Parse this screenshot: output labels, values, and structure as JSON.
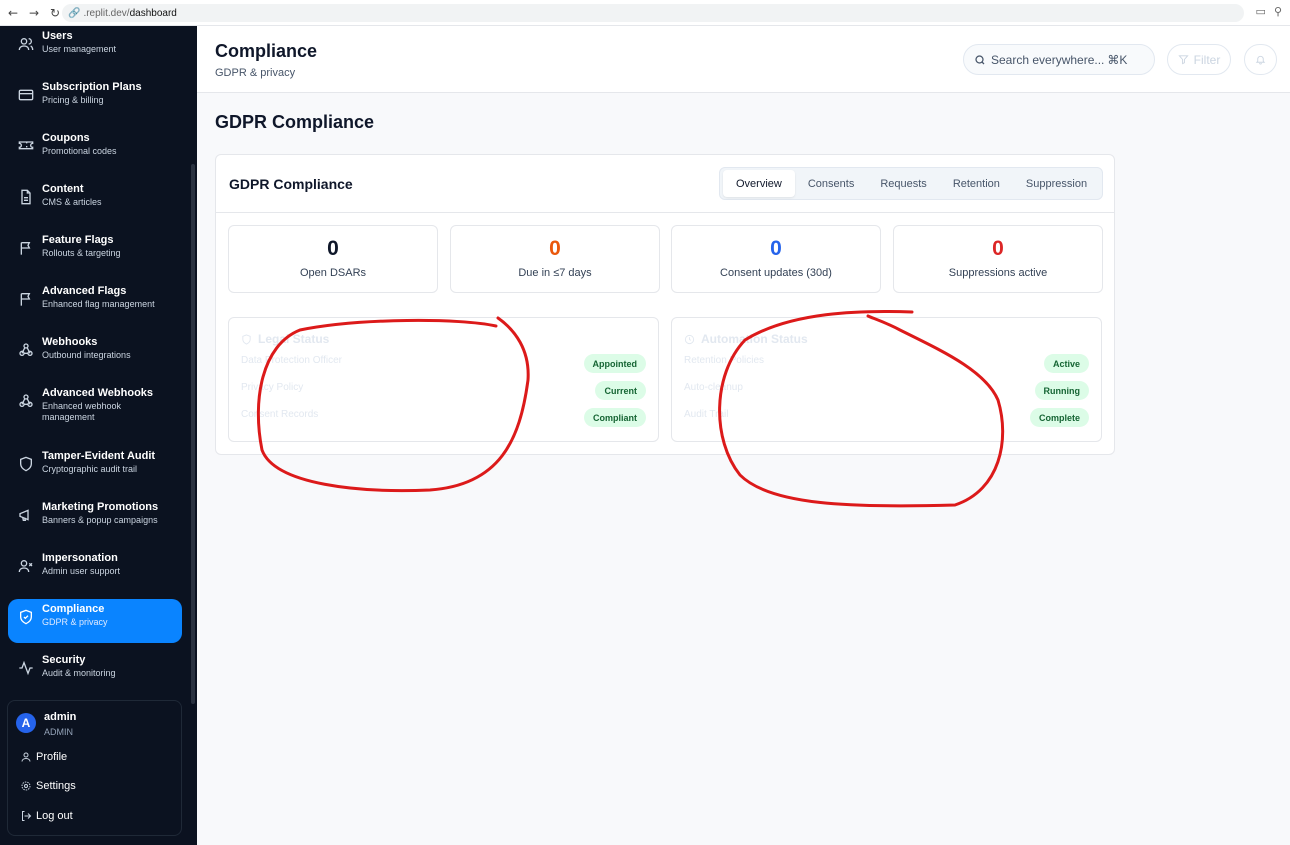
{
  "browser": {
    "url_prefix": ".replit.dev/",
    "url_path": "dashboard"
  },
  "sidebar": {
    "items": [
      {
        "title": "Users",
        "sub": "User management",
        "icon": "users-icon"
      },
      {
        "title": "Subscription Plans",
        "sub": "Pricing & billing",
        "icon": "credit-card-icon"
      },
      {
        "title": "Coupons",
        "sub": "Promotional codes",
        "icon": "ticket-icon"
      },
      {
        "title": "Content",
        "sub": "CMS & articles",
        "icon": "file-text-icon"
      },
      {
        "title": "Feature Flags",
        "sub": "Rollouts & targeting",
        "icon": "flag-icon"
      },
      {
        "title": "Advanced Flags",
        "sub": "Enhanced flag management",
        "icon": "flag-icon"
      },
      {
        "title": "Webhooks",
        "sub": "Outbound integrations",
        "icon": "webhook-icon"
      },
      {
        "title": "Advanced Webhooks",
        "sub": "Enhanced webhook management",
        "icon": "webhook-icon"
      },
      {
        "title": "Tamper-Evident Audit",
        "sub": "Cryptographic audit trail",
        "icon": "shield-icon"
      },
      {
        "title": "Marketing Promotions",
        "sub": "Banners & popup campaigns",
        "icon": "megaphone-icon"
      },
      {
        "title": "Impersonation",
        "sub": "Admin user support",
        "icon": "user-x-icon"
      },
      {
        "title": "Compliance",
        "sub": "GDPR & privacy",
        "icon": "shield-check-icon"
      },
      {
        "title": "Security",
        "sub": "Audit & monitoring",
        "icon": "activity-icon"
      }
    ],
    "active_index": 11,
    "user": {
      "avatar_letter": "A",
      "name": "admin",
      "role": "ADMIN",
      "menu": [
        "Profile",
        "Settings",
        "Log out"
      ]
    }
  },
  "header": {
    "title": "Compliance",
    "subtitle": "GDPR & privacy",
    "search_placeholder": "Search everywhere...",
    "search_shortcut": "⌘K",
    "filter_label": "Filter"
  },
  "main": {
    "heading": "GDPR Compliance",
    "card": {
      "title": "GDPR Compliance",
      "tabs": [
        "Overview",
        "Consents",
        "Requests",
        "Retention",
        "Suppression"
      ],
      "active_tab": 0,
      "stats": [
        {
          "value": "0",
          "label": "Open DSARs",
          "color": "#0f172a"
        },
        {
          "value": "0",
          "label": "Due in ≤7 days",
          "color": "#ea580c"
        },
        {
          "value": "0",
          "label": "Consent updates (30d)",
          "color": "#2563eb"
        },
        {
          "value": "0",
          "label": "Suppressions active",
          "color": "#dc2626"
        }
      ],
      "panels": [
        {
          "title": "Legal Status",
          "rows": [
            {
              "label": "Data Protection Officer",
              "badge": "Appointed"
            },
            {
              "label": "Privacy Policy",
              "badge": "Current"
            },
            {
              "label": "Consent Records",
              "badge": "Compliant"
            }
          ]
        },
        {
          "title": "Automation Status",
          "rows": [
            {
              "label": "Retention Policies",
              "badge": "Active"
            },
            {
              "label": "Auto-cleanup",
              "badge": "Running"
            },
            {
              "label": "Audit Trail",
              "badge": "Complete"
            }
          ]
        }
      ]
    }
  },
  "colors": {
    "sidebar_bg": "#0b1220",
    "accent": "#0a84ff",
    "annotation": "#dc1a1a",
    "badge_bg": "#dcfce7",
    "badge_text": "#166534"
  }
}
